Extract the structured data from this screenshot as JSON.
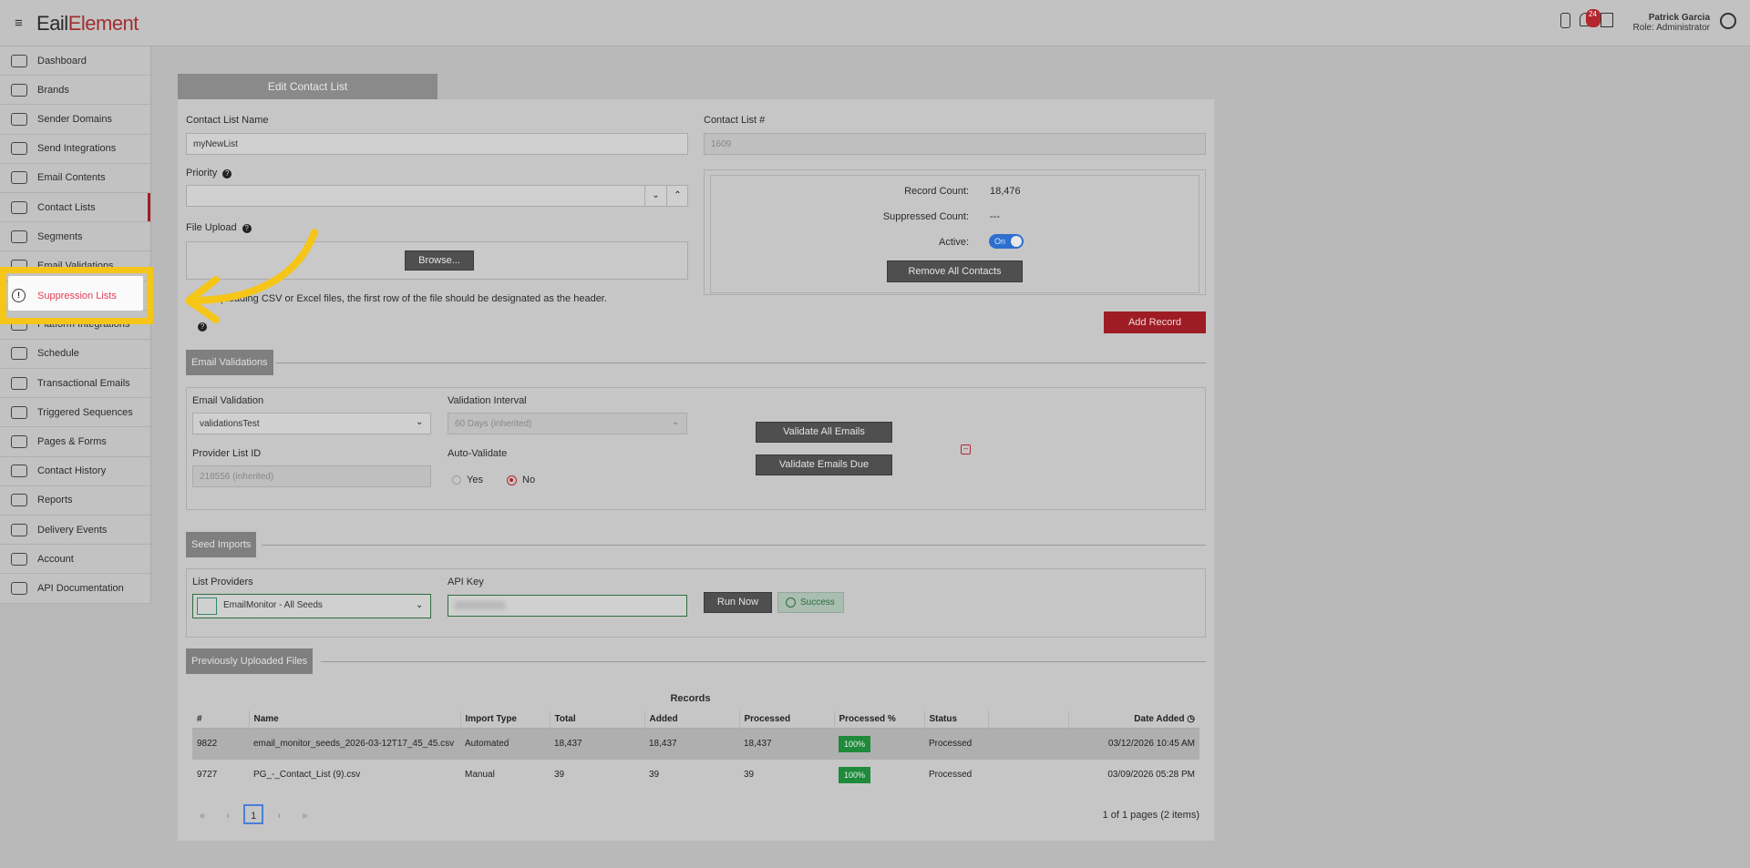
{
  "topbar": {
    "logo_part1": "E",
    "logo_part2": "ail",
    "logo_part3": "Element",
    "notification_count": "24",
    "user_name": "Patrick Garcia",
    "user_role": "Role: Administrator"
  },
  "sidebar": {
    "items": [
      {
        "label": "Dashboard",
        "icon": "dashboard-icon"
      },
      {
        "label": "Brands",
        "icon": "brands-icon"
      },
      {
        "label": "Sender Domains",
        "icon": "globe-icon"
      },
      {
        "label": "Send Integrations",
        "icon": "wrench-icon"
      },
      {
        "label": "Email Contents",
        "icon": "envelope-icon"
      },
      {
        "label": "Contact Lists",
        "icon": "book-icon"
      },
      {
        "label": "Segments",
        "icon": "segments-icon"
      },
      {
        "label": "Email Validations",
        "icon": "check-circle-icon"
      },
      {
        "label": "Suppression Lists",
        "icon": "alert-circle-icon"
      },
      {
        "label": "Platform Integrations",
        "icon": "plug-icon"
      },
      {
        "label": "Schedule",
        "icon": "clock-icon"
      },
      {
        "label": "Transactional Emails",
        "icon": "at-icon"
      },
      {
        "label": "Triggered Sequences",
        "icon": "bolt-icon"
      },
      {
        "label": "Pages & Forms",
        "icon": "page-icon"
      },
      {
        "label": "Contact History",
        "icon": "clipboard-icon"
      },
      {
        "label": "Reports",
        "icon": "pie-icon"
      },
      {
        "label": "Delivery Events",
        "icon": "bar-chart-icon"
      },
      {
        "label": "Account",
        "icon": "user-icon"
      },
      {
        "label": "API Documentation",
        "icon": "doc-icon"
      }
    ]
  },
  "tab_title": "Edit Contact List",
  "form": {
    "list_name_label": "Contact List Name",
    "list_name_value": "myNewList",
    "list_num_label": "Contact List #",
    "list_num_value": "1609",
    "priority_label": "Priority",
    "file_upload_label": "File Upload",
    "browse_label": "Browse...",
    "upload_hint": "...ploading CSV or Excel files, the first row of the file should be designated as the header."
  },
  "stats": {
    "record_count_label": "Record Count:",
    "record_count_value": "18,476",
    "suppressed_label": "Suppressed Count:",
    "suppressed_value": "---",
    "active_label": "Active:",
    "active_toggle": "On",
    "remove_all_label": "Remove All Contacts",
    "add_record_label": "Add Record"
  },
  "validations": {
    "section_title": "Email Validations",
    "email_validation_label": "Email Validation",
    "email_validation_value": "validationsTest",
    "interval_label": "Validation Interval",
    "interval_value": "60 Days (inherited)",
    "provider_id_label": "Provider List ID",
    "provider_id_value": "218556 (inherited)",
    "auto_validate_label": "Auto-Validate",
    "yes_label": "Yes",
    "no_label": "No",
    "validate_all_label": "Validate All Emails",
    "validate_due_label": "Validate Emails Due"
  },
  "seeds": {
    "section_title": "Seed Imports",
    "providers_label": "List Providers",
    "providers_value": "EmailMonitor - All Seeds",
    "api_key_label": "API Key",
    "run_now_label": "Run Now",
    "success_label": "Success"
  },
  "files": {
    "section_title": "Previously Uploaded Files",
    "records_header": "Records",
    "headers": [
      "#",
      "Name",
      "Import Type",
      "Total",
      "Added",
      "Processed",
      "Processed %",
      "Status",
      "",
      "Date Added"
    ],
    "rows": [
      {
        "num": "9822",
        "name": "email_monitor_seeds_2026-03-12T17_45_45.csv",
        "type": "Automated",
        "total": "18,437",
        "added": "18,437",
        "processed": "18,437",
        "pct": "100%",
        "status": "Processed",
        "date": "03/12/2026 10:45 AM"
      },
      {
        "num": "9727",
        "name": "PG_-_Contact_List (9).csv",
        "type": "Manual",
        "total": "39",
        "added": "39",
        "processed": "39",
        "pct": "100%",
        "status": "Processed",
        "date": "03/09/2026 05:28 PM"
      }
    ],
    "pager_first": "«",
    "pager_prev": "‹",
    "pager_current": "1",
    "pager_next": "›",
    "pager_last": "»",
    "pager_summary": "1 of 1 pages (2 items)"
  }
}
